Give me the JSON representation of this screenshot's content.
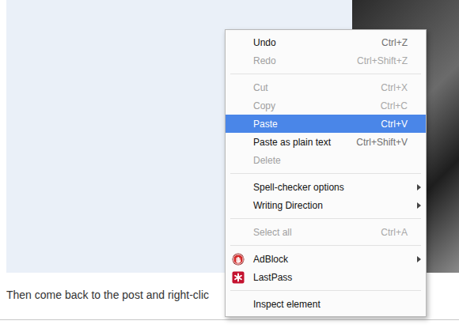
{
  "page": {
    "caption": "Then come back to the post and right-clic"
  },
  "context_menu": {
    "items": [
      {
        "kind": "command",
        "label": "Undo",
        "shortcut": "Ctrl+Z",
        "disabled": false,
        "selected": false,
        "submenu": false
      },
      {
        "kind": "command",
        "label": "Redo",
        "shortcut": "Ctrl+Shift+Z",
        "disabled": true,
        "selected": false,
        "submenu": false
      },
      {
        "kind": "separator"
      },
      {
        "kind": "command",
        "label": "Cut",
        "shortcut": "Ctrl+X",
        "disabled": true,
        "selected": false,
        "submenu": false
      },
      {
        "kind": "command",
        "label": "Copy",
        "shortcut": "Ctrl+C",
        "disabled": true,
        "selected": false,
        "submenu": false
      },
      {
        "kind": "command",
        "label": "Paste",
        "shortcut": "Ctrl+V",
        "disabled": false,
        "selected": true,
        "submenu": false
      },
      {
        "kind": "command",
        "label": "Paste as plain text",
        "shortcut": "Ctrl+Shift+V",
        "disabled": false,
        "selected": false,
        "submenu": false
      },
      {
        "kind": "command",
        "label": "Delete",
        "shortcut": "",
        "disabled": true,
        "selected": false,
        "submenu": false
      },
      {
        "kind": "separator"
      },
      {
        "kind": "command",
        "label": "Spell-checker options",
        "shortcut": "",
        "disabled": false,
        "selected": false,
        "submenu": true
      },
      {
        "kind": "command",
        "label": "Writing Direction",
        "shortcut": "",
        "disabled": false,
        "selected": false,
        "submenu": true
      },
      {
        "kind": "separator"
      },
      {
        "kind": "command",
        "label": "Select all",
        "shortcut": "Ctrl+A",
        "disabled": true,
        "selected": false,
        "submenu": false
      },
      {
        "kind": "separator"
      },
      {
        "kind": "adblock",
        "label": "AdBlock",
        "shortcut": "",
        "disabled": false,
        "selected": false,
        "submenu": true
      },
      {
        "kind": "lastpass",
        "label": "LastPass",
        "shortcut": "",
        "disabled": false,
        "selected": false,
        "submenu": false
      },
      {
        "kind": "separator"
      },
      {
        "kind": "command",
        "label": "Inspect element",
        "shortcut": "",
        "disabled": false,
        "selected": false,
        "submenu": false
      }
    ]
  }
}
